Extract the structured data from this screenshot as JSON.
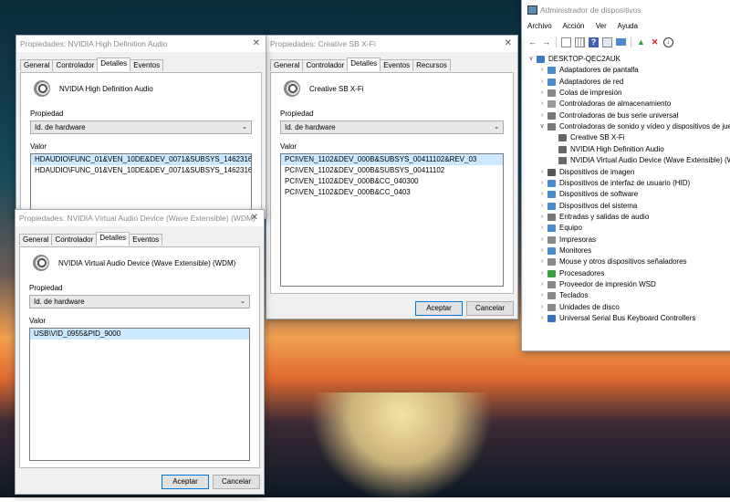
{
  "nvidia_hd": {
    "title": "Propiedades: NVIDIA High Definition Audio",
    "tabs": [
      "General",
      "Controlador",
      "Detalles",
      "Eventos"
    ],
    "device_name": "NVIDIA High Definition Audio",
    "property_label": "Propiedad",
    "property_value": "Id. de hardware",
    "value_label": "Valor",
    "values": [
      "HDAUDIO\\FUNC_01&VEN_10DE&DEV_0071&SUBSYS_14623160&REV_1001",
      "HDAUDIO\\FUNC_01&VEN_10DE&DEV_0071&SUBSYS_14623160"
    ]
  },
  "creative": {
    "title": "Propiedades: Creative SB X-Fi",
    "tabs": [
      "General",
      "Controlador",
      "Detalles",
      "Eventos",
      "Recursos"
    ],
    "device_name": "Creative SB X-Fi",
    "property_label": "Propiedad",
    "property_value": "Id. de hardware",
    "value_label": "Valor",
    "values": [
      "PCI\\VEN_1102&DEV_000B&SUBSYS_00411102&REV_03",
      "PCI\\VEN_1102&DEV_000B&SUBSYS_00411102",
      "PCI\\VEN_1102&DEV_000B&CC_040300",
      "PCI\\VEN_1102&DEV_000B&CC_0403"
    ],
    "ok_label": "Aceptar",
    "cancel_label": "Cancelar"
  },
  "nvidia_virtual": {
    "title": "Propiedades: NVIDIA Virtual Audio Device (Wave Extensible) (WDM)",
    "tabs": [
      "General",
      "Controlador",
      "Detalles",
      "Eventos"
    ],
    "device_name": "NVIDIA Virtual Audio Device (Wave Extensible) (WDM)",
    "property_label": "Propiedad",
    "property_value": "Id. de hardware",
    "value_label": "Valor",
    "values": [
      "USB\\VID_0955&PID_9000"
    ],
    "ok_label": "Aceptar",
    "cancel_label": "Cancelar"
  },
  "device_manager": {
    "title": "Administrador de dispositivos",
    "menu": [
      "Archivo",
      "Acción",
      "Ver",
      "Ayuda"
    ],
    "toolbar_icons": [
      "back-icon",
      "forward-icon",
      "properties-icon",
      "grid-icon",
      "help-icon",
      "update-driver-icon",
      "monitor-icon",
      "enable-device-icon",
      "uninstall-icon",
      "download-icon"
    ],
    "tree": [
      {
        "label": "DESKTOP-QEC2AUK",
        "level": 0,
        "expanded": true,
        "color": "#3b78c4"
      },
      {
        "label": "Adaptadores de pantalla",
        "level": 1,
        "color": "#4a8bd0"
      },
      {
        "label": "Adaptadores de red",
        "level": 1,
        "color": "#4a8bd0"
      },
      {
        "label": "Colas de impresión",
        "level": 1,
        "color": "#888888"
      },
      {
        "label": "Controladoras de almacenamiento",
        "level": 1,
        "color": "#999999"
      },
      {
        "label": "Controladoras de bus serie universal",
        "level": 1,
        "color": "#777777"
      },
      {
        "label": "Controladoras de sonido y vídeo y dispositivos de juego",
        "level": 1,
        "expanded": true,
        "color": "#777777"
      },
      {
        "label": "Creative SB X-Fi",
        "level": 2,
        "color": "#666666"
      },
      {
        "label": "NVIDIA High Definition Audio",
        "level": 2,
        "color": "#666666"
      },
      {
        "label": "NVIDIA Virtual Audio Device (Wave Extensible) (WDM)",
        "level": 2,
        "color": "#666666"
      },
      {
        "label": "Dispositivos de imagen",
        "level": 1,
        "color": "#555555"
      },
      {
        "label": "Dispositivos de interfaz de usuario (HID)",
        "level": 1,
        "color": "#4a8bd0"
      },
      {
        "label": "Dispositivos de software",
        "level": 1,
        "color": "#4a8bd0"
      },
      {
        "label": "Dispositivos del sistema",
        "level": 1,
        "color": "#4a8bd0"
      },
      {
        "label": "Entradas y salidas de audio",
        "level": 1,
        "color": "#777777"
      },
      {
        "label": "Equipo",
        "level": 1,
        "color": "#4a8bd0"
      },
      {
        "label": "Impresoras",
        "level": 1,
        "color": "#888888"
      },
      {
        "label": "Monitores",
        "level": 1,
        "color": "#4a8bd0"
      },
      {
        "label": "Mouse y otros dispositivos señaladores",
        "level": 1,
        "color": "#888888"
      },
      {
        "label": "Procesadores",
        "level": 1,
        "color": "#3aa048"
      },
      {
        "label": "Proveedor de impresión WSD",
        "level": 1,
        "color": "#888888"
      },
      {
        "label": "Teclados",
        "level": 1,
        "color": "#888888"
      },
      {
        "label": "Unidades de disco",
        "level": 1,
        "color": "#888888"
      },
      {
        "label": "Universal Serial Bus Keyboard Controllers",
        "level": 1,
        "color": "#3b6fc4"
      }
    ]
  }
}
